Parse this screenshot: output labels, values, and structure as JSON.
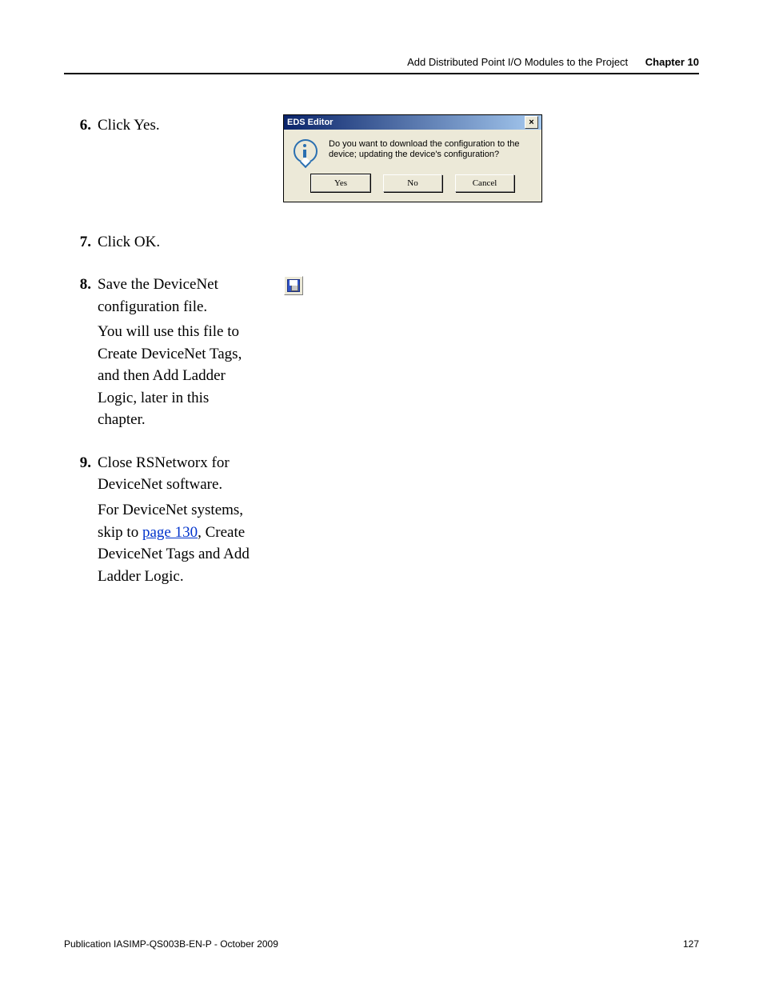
{
  "header": {
    "section": "Add Distributed Point I/O Modules to the Project",
    "chapter": "Chapter 10"
  },
  "list": {
    "i6": {
      "num": "6.",
      "text": "Click Yes."
    },
    "i7": {
      "num": "7.",
      "text": "Click OK."
    },
    "i8": {
      "num": "8.",
      "text": "Save the DeviceNet configuration file.",
      "para": "You will use this file to Create DeviceNet Tags, and then Add Ladder Logic, later in this chapter."
    },
    "i9": {
      "num": "9.",
      "text": "Close RSNetworx for DeviceNet software.",
      "para_pre": "For DeviceNet systems, skip to ",
      "link": "page 130",
      "para_post": ", Create DeviceNet Tags and Add Ladder Logic."
    }
  },
  "dialog": {
    "title": "EDS Editor",
    "close": "×",
    "message": "Do you want to download the configuration to the device; updating the device's configuration?",
    "yes": "Yes",
    "no": "No",
    "cancel": "Cancel"
  },
  "footer": {
    "pub": "Publication IASIMP-QS003B-EN-P - October 2009",
    "page": "127"
  }
}
